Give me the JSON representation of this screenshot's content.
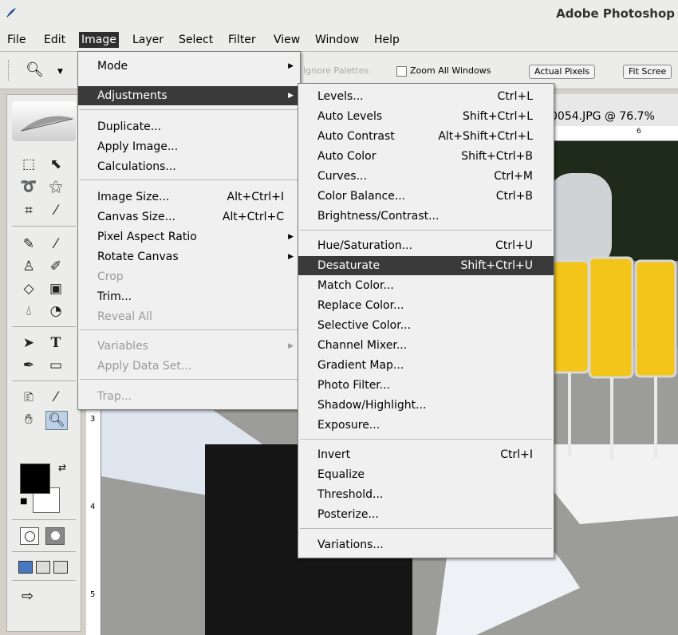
{
  "window": {
    "title": "Adobe Photoshop"
  },
  "menubar": [
    "File",
    "Edit",
    "Image",
    "Layer",
    "Select",
    "Filter",
    "View",
    "Window",
    "Help"
  ],
  "options": {
    "ignore_palettes": "Ignore Palettes",
    "zoom_all_windows": "Zoom All Windows",
    "actual_pixels": "Actual Pixels",
    "fit_screen": "Fit Scree"
  },
  "document": {
    "title_fragment": "0054.JPG @ 76.7%",
    "ruler_marks": [
      "3",
      "4",
      "5"
    ],
    "ruler_top_mark": "6"
  },
  "image_menu": [
    {
      "label": "Mode",
      "shortcut": "",
      "submenu": true
    },
    {
      "label": "Adjustments",
      "shortcut": "",
      "submenu": true,
      "highlighted": true
    },
    {
      "label": "Duplicate...",
      "shortcut": ""
    },
    {
      "label": "Apply Image...",
      "shortcut": ""
    },
    {
      "label": "Calculations...",
      "shortcut": ""
    },
    {
      "label": "Image Size...",
      "shortcut": "Alt+Ctrl+I"
    },
    {
      "label": "Canvas Size...",
      "shortcut": "Alt+Ctrl+C"
    },
    {
      "label": "Pixel Aspect Ratio",
      "shortcut": "",
      "submenu": true
    },
    {
      "label": "Rotate Canvas",
      "shortcut": "",
      "submenu": true
    },
    {
      "label": "Crop",
      "shortcut": "",
      "disabled": true
    },
    {
      "label": "Trim...",
      "shortcut": ""
    },
    {
      "label": "Reveal All",
      "shortcut": "",
      "disabled": true
    },
    {
      "label": "Variables",
      "shortcut": "",
      "submenu": true,
      "disabled": true
    },
    {
      "label": "Apply Data Set...",
      "shortcut": "",
      "disabled": true
    },
    {
      "label": "Trap...",
      "shortcut": "",
      "disabled": true
    }
  ],
  "adjustments_menu": [
    {
      "label": "Levels...",
      "shortcut": "Ctrl+L"
    },
    {
      "label": "Auto Levels",
      "shortcut": "Shift+Ctrl+L"
    },
    {
      "label": "Auto Contrast",
      "shortcut": "Alt+Shift+Ctrl+L"
    },
    {
      "label": "Auto Color",
      "shortcut": "Shift+Ctrl+B"
    },
    {
      "label": "Curves...",
      "shortcut": "Ctrl+M"
    },
    {
      "label": "Color Balance...",
      "shortcut": "Ctrl+B"
    },
    {
      "label": "Brightness/Contrast...",
      "shortcut": ""
    },
    {
      "label": "Hue/Saturation...",
      "shortcut": "Ctrl+U"
    },
    {
      "label": "Desaturate",
      "shortcut": "Shift+Ctrl+U",
      "highlighted": true
    },
    {
      "label": "Match Color...",
      "shortcut": ""
    },
    {
      "label": "Replace Color...",
      "shortcut": ""
    },
    {
      "label": "Selective Color...",
      "shortcut": ""
    },
    {
      "label": "Channel Mixer...",
      "shortcut": ""
    },
    {
      "label": "Gradient Map...",
      "shortcut": ""
    },
    {
      "label": "Photo Filter...",
      "shortcut": ""
    },
    {
      "label": "Shadow/Highlight...",
      "shortcut": ""
    },
    {
      "label": "Exposure...",
      "shortcut": ""
    },
    {
      "label": "Invert",
      "shortcut": "Ctrl+I"
    },
    {
      "label": "Equalize",
      "shortcut": ""
    },
    {
      "label": "Threshold...",
      "shortcut": ""
    },
    {
      "label": "Posterize...",
      "shortcut": ""
    },
    {
      "label": "Variations...",
      "shortcut": ""
    }
  ],
  "colors": {
    "menu_highlight": "#3a3a3a",
    "foreground": "#000000",
    "background": "#ffffff"
  }
}
